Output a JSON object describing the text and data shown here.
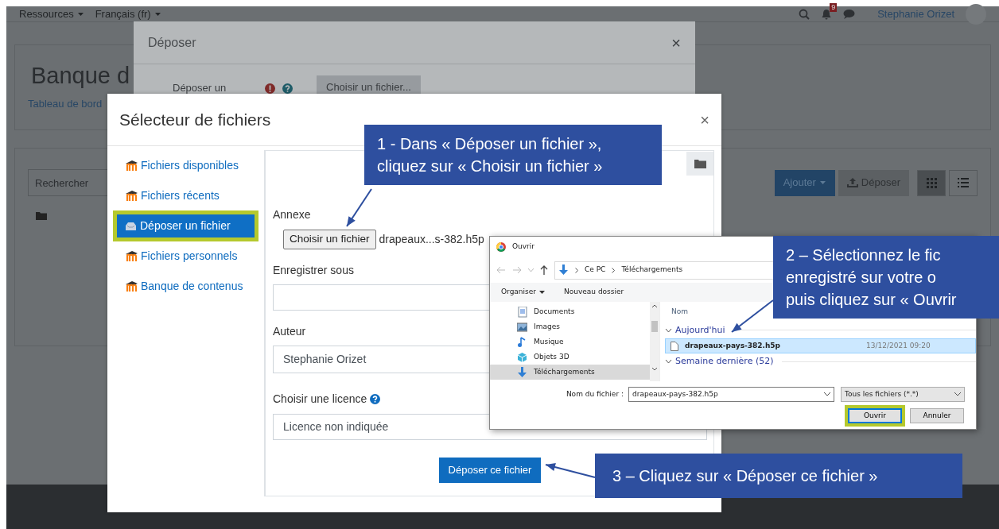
{
  "page": {
    "nav": {
      "menus": [
        {
          "label": "Ressources"
        },
        {
          "label": "Français (fr)"
        }
      ],
      "notification_count": "9",
      "user_name": "Stephanie Orizet"
    },
    "heading": "Banque d",
    "breadcrumb": "Tableau de bord",
    "search": {
      "placeholder": "Rechercher"
    },
    "buttons": [
      {
        "label": "Ajouter",
        "kind": "dropdown"
      },
      {
        "label": "Déposer",
        "kind": "upload"
      }
    ],
    "view_toggles": [
      {
        "kind": "grid",
        "selected": true
      },
      {
        "kind": "list",
        "selected": false
      }
    ]
  },
  "upload_dialog": {
    "title": "Déposer",
    "close": "×",
    "field_label": "Déposer un",
    "button": "Choisir un fichier..."
  },
  "file_picker": {
    "title": "Sélecteur de fichiers",
    "close": "×",
    "repositories": [
      {
        "label": "Fichiers disponibles",
        "kind": "moodle",
        "selected": false,
        "highlighted": false
      },
      {
        "label": "Fichiers récents",
        "kind": "moodle",
        "selected": false,
        "highlighted": false
      },
      {
        "label": "Déposer un fichier",
        "kind": "upload",
        "selected": true,
        "highlighted": true
      },
      {
        "label": "Fichiers personnels",
        "kind": "moodle",
        "selected": false,
        "highlighted": false
      },
      {
        "label": "Banque de contenus",
        "kind": "moodle",
        "selected": false,
        "highlighted": false
      }
    ],
    "form": {
      "attachment_label": "Annexe",
      "choose_button": "Choisir un fichier",
      "chosen_file": "drapeaux...s-382.h5p",
      "save_as_label": "Enregistrer sous",
      "author_label": "Auteur",
      "author_value": "Stephanie Orizet",
      "license_label": "Choisir une licence",
      "license_value": "Licence non indiquée",
      "submit": "Déposer ce fichier"
    }
  },
  "open_dialog": {
    "title": "Ouvrir",
    "path": [
      "Ce PC",
      "Téléchargements"
    ],
    "toolbar": [
      {
        "label": "Organiser",
        "kind": "menu"
      },
      {
        "label": "Nouveau dossier",
        "kind": "button"
      }
    ],
    "folders": [
      {
        "label": "Documents",
        "kind": "documents",
        "selected": false
      },
      {
        "label": "Images",
        "kind": "images",
        "selected": false
      },
      {
        "label": "Musique",
        "kind": "music",
        "selected": false
      },
      {
        "label": "Objets 3D",
        "kind": "objects",
        "selected": false
      },
      {
        "label": "Téléchargements",
        "kind": "downloads",
        "selected": true
      }
    ],
    "column": "Nom",
    "groups": [
      {
        "label": "Aujourd'hui",
        "files": [
          {
            "name": "drapeaux-pays-382.h5p",
            "date": "13/12/2021 09:20",
            "selected": true
          }
        ]
      },
      {
        "label": "Semaine dernière (52)"
      }
    ],
    "filename_label": "Nom du fichier :",
    "filename_value": "drapeaux-pays-382.h5p",
    "filter": "Tous les fichiers (*.*)",
    "buttons": [
      {
        "label": "Ouvrir",
        "highlighted": true
      },
      {
        "label": "Annuler",
        "highlighted": false
      }
    ]
  },
  "callouts": [
    {
      "lines": [
        "1 - Dans « Déposer un fichier »,",
        "cliquez sur « Choisir un fichier »"
      ]
    },
    {
      "lines": [
        "2 – Sélectionnez le fic",
        "enregistré sur votre o",
        "puis cliquez sur « Ouvrir"
      ]
    },
    {
      "lines": [
        "3 – Cliquez sur « Déposer ce fichier »"
      ]
    }
  ]
}
